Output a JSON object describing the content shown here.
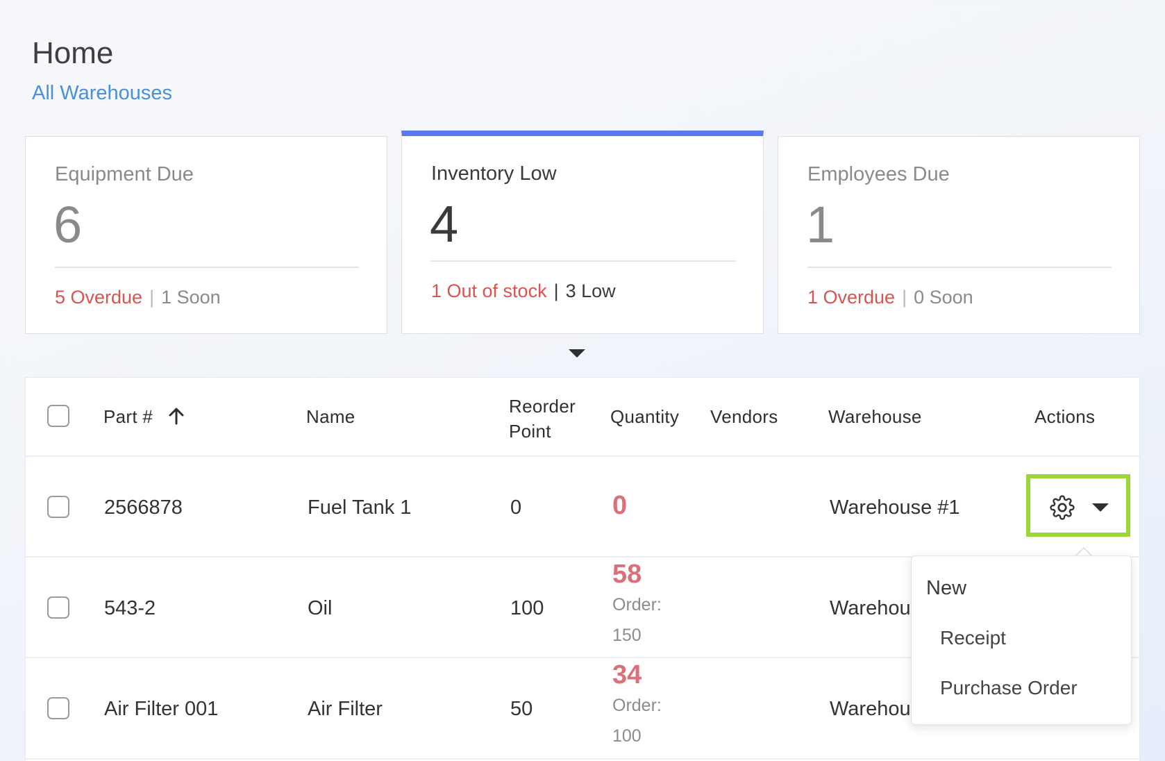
{
  "header": {
    "title": "Home",
    "warehouse_link": "All Warehouses"
  },
  "cards": [
    {
      "title": "Equipment Due",
      "count": "6",
      "primary": "5 Overdue",
      "separator": "|",
      "secondary": "1 Soon",
      "active": false
    },
    {
      "title": "Inventory Low",
      "count": "4",
      "primary": "1 Out of stock",
      "separator": "|",
      "secondary": "3 Low",
      "active": true
    },
    {
      "title": "Employees Due",
      "count": "1",
      "primary": "1 Overdue",
      "separator": "|",
      "secondary": "0 Soon",
      "active": false
    }
  ],
  "table": {
    "columns": {
      "part": "Part #",
      "part_sort_icon": "arrow-up-icon",
      "name": "Name",
      "reorder_line1": "Reorder",
      "reorder_line2": "Point",
      "quantity": "Quantity",
      "vendors": "Vendors",
      "warehouse": "Warehouse",
      "actions": "Actions"
    },
    "rows": [
      {
        "part": "2566878",
        "name": "Fuel Tank 1",
        "reorder": "0",
        "qty": "0",
        "order_label": "",
        "order_value": "",
        "vendors": "",
        "warehouse": "Warehouse #1"
      },
      {
        "part": "543-2",
        "name": "Oil",
        "reorder": "100",
        "qty": "58",
        "order_label": "Order:",
        "order_value": "150",
        "vendors": "",
        "warehouse": "Warehou"
      },
      {
        "part": "Air Filter 001",
        "name": "Air Filter",
        "reorder": "50",
        "qty": "34",
        "order_label": "Order:",
        "order_value": "100",
        "vendors": "",
        "warehouse": "Warehou"
      }
    ]
  },
  "actions": {
    "gear_icon": "gear-icon",
    "caret_icon": "chevron-down-icon",
    "menu": {
      "header": "New",
      "items": [
        "Receipt",
        "Purchase Order"
      ]
    }
  },
  "colors": {
    "accent_blue": "#5a78f0",
    "link_blue": "#4a90d9",
    "alert_red": "#d9534f",
    "qty_red": "#d9707a",
    "highlight_green": "#9ed63a"
  }
}
